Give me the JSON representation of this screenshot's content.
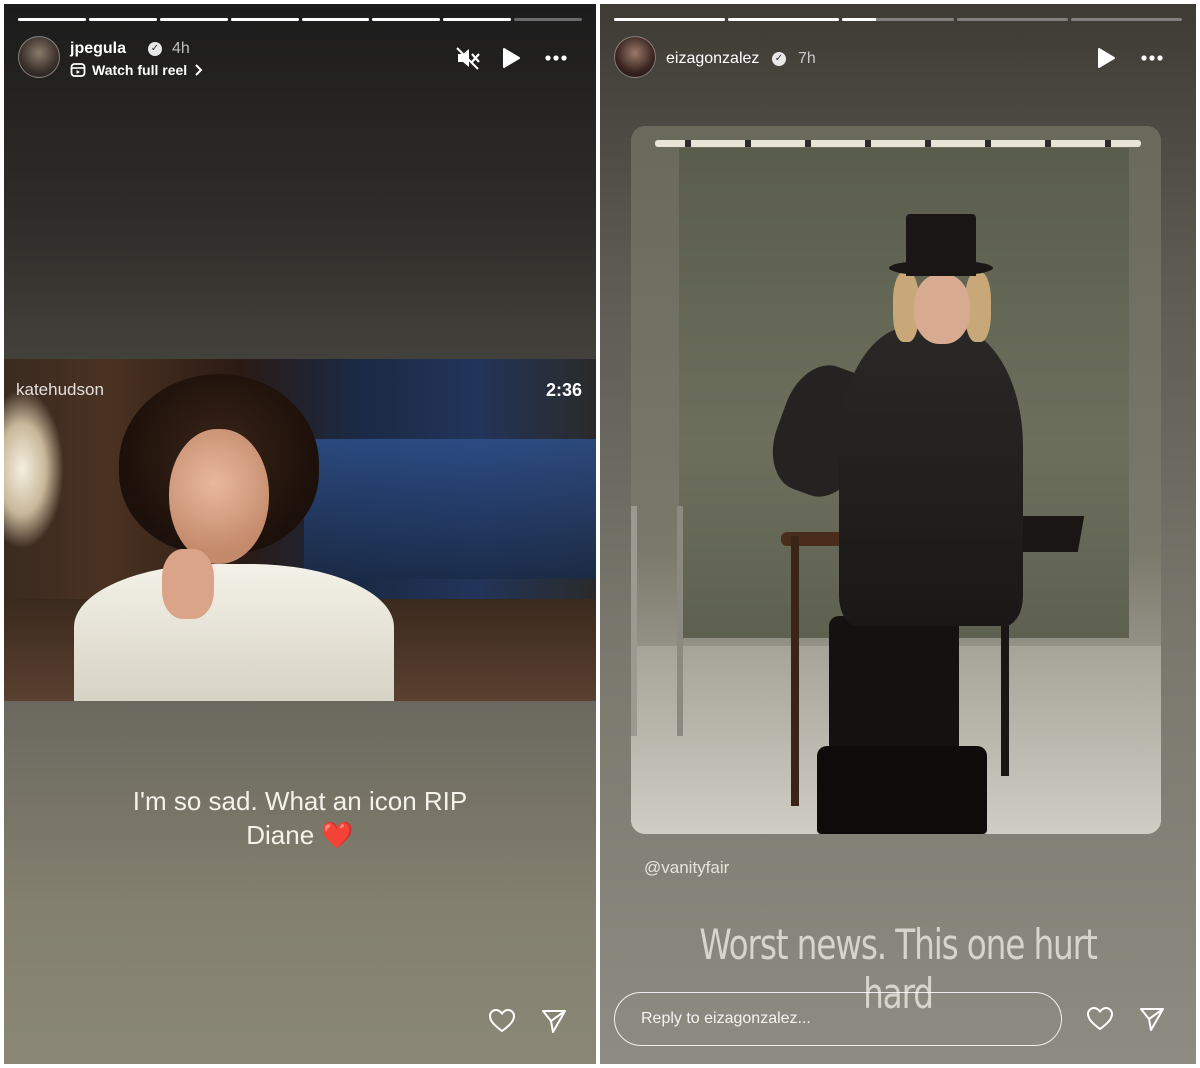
{
  "left_story": {
    "progress": [
      1,
      1,
      1,
      1,
      1,
      1,
      1,
      0
    ],
    "username": "jpegula",
    "time": "4h",
    "subtitle": "Watch full reel",
    "video": {
      "username": "katehudson",
      "duration": "2:36"
    },
    "caption_line1": "I'm so sad. What an icon RIP",
    "caption_line2": "Diane",
    "caption_emoji": "❤️"
  },
  "right_story": {
    "progress": [
      1,
      1,
      0.3,
      0,
      0
    ],
    "username": "eizagonzalez",
    "time": "7h",
    "tag": "@vanityfair",
    "caption": "Worst news.  This one hurt hard",
    "reply_placeholder": "Reply to eizagonzalez..."
  },
  "icons": [
    "mute-icon",
    "play-icon",
    "more-icon",
    "like-heart-icon",
    "send-icon",
    "verified-badge-icon",
    "reel-icon",
    "chevron-right-icon"
  ],
  "colors": {
    "progress_active": "#ffffff",
    "progress_inactive": "rgba(255,255,255,0.35)",
    "heart_emoji": "#d9141e"
  }
}
